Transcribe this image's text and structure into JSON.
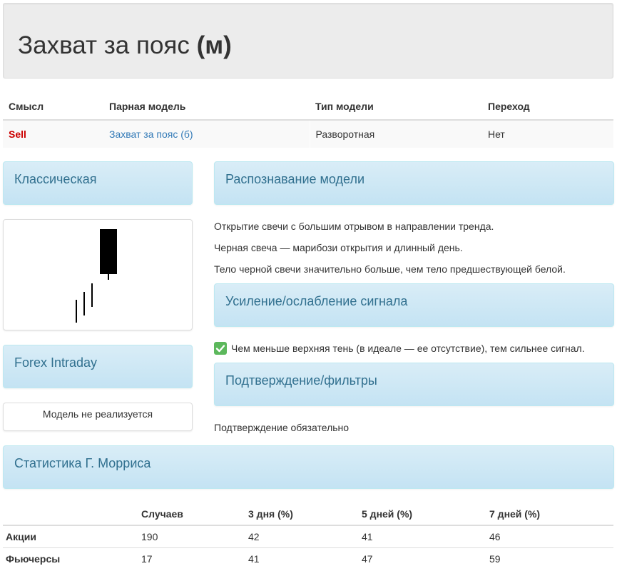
{
  "header": {
    "title_main": "Захват за пояс",
    "title_suffix": "(м)"
  },
  "info_table": {
    "headers": [
      "Смысл",
      "Парная модель",
      "Тип модели",
      "Переход"
    ],
    "row": {
      "meaning": "Sell",
      "pair_model": "Захват за пояс (б)",
      "model_type": "Разворотная",
      "transition": "Нет"
    }
  },
  "panels": {
    "classic": "Классическая",
    "recognition": "Распознавание модели",
    "forex": "Forex Intraday",
    "signal": "Усиление/ослабление сигнала",
    "confirm": "Подтверждение/фильтры",
    "stats": "Статистика Г. Морриса"
  },
  "recognition_lines": [
    "Открытие свечи с большим отрывом в направлении тренда.",
    "Черная свеча — марибози открытия и длинный день.",
    "Тело черной свечи значительно больше, чем тело предшествующей белой."
  ],
  "signal_text": "Чем меньше верхняя тень (в идеале — ее отсутствие), тем сильнее сигнал.",
  "forex_text": "Модель не реализуется",
  "confirm_text": "Подтверждение обязательно",
  "stats_table": {
    "headers": [
      "",
      "Случаев",
      "3 дня (%)",
      "5 дней (%)",
      "7 дней (%)"
    ],
    "rows": [
      [
        "Акции",
        "190",
        "42",
        "41",
        "46"
      ],
      [
        "Фьючерсы",
        "17",
        "41",
        "47",
        "59"
      ]
    ]
  },
  "colors": {
    "sell": "#cc0000",
    "link": "#337ab7",
    "panel_heading_text": "#31708f",
    "check": "#5cb85c"
  }
}
